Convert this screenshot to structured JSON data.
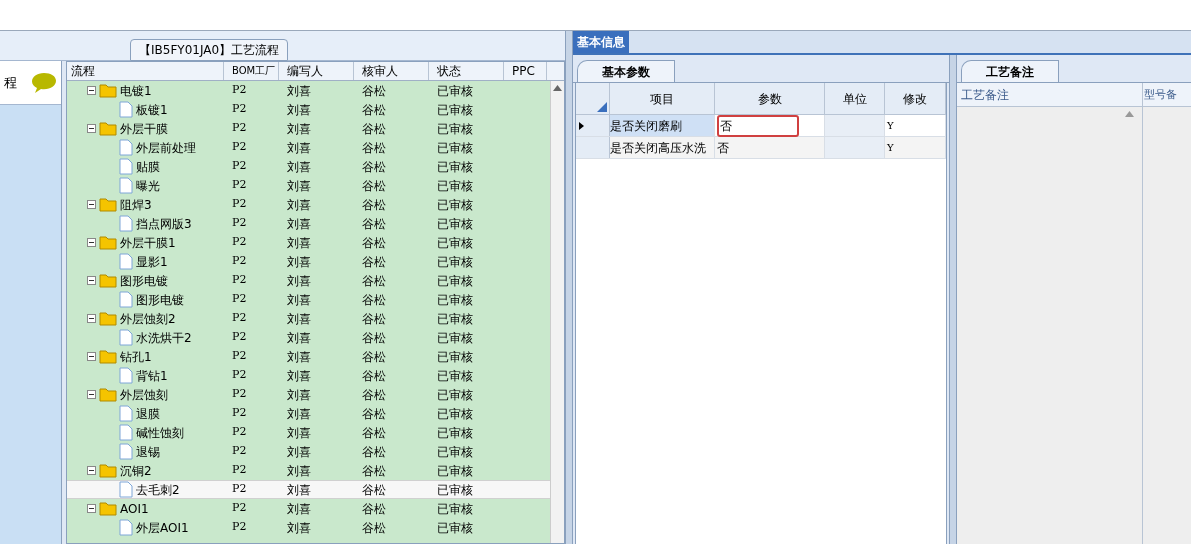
{
  "flow_panel": {
    "title": "【IB5FY01JA0】工艺流程",
    "left_header": "程",
    "columns": [
      "流程",
      "BOM工厂",
      "编写人",
      "核审人",
      "状态",
      "PPC"
    ],
    "tree": [
      {
        "label": "电镀1",
        "bom": "P2",
        "writer": "刘喜",
        "reviewer": "谷松",
        "status": "已审核",
        "selected": false,
        "children": [
          {
            "label": "板镀1",
            "bom": "P2",
            "writer": "刘喜",
            "reviewer": "谷松",
            "status": "已审核",
            "selected": false
          }
        ]
      },
      {
        "label": "外层干膜",
        "bom": "P2",
        "writer": "刘喜",
        "reviewer": "谷松",
        "status": "已审核",
        "selected": false,
        "children": [
          {
            "label": "外层前处理",
            "bom": "P2",
            "writer": "刘喜",
            "reviewer": "谷松",
            "status": "已审核",
            "selected": false
          },
          {
            "label": "贴膜",
            "bom": "P2",
            "writer": "刘喜",
            "reviewer": "谷松",
            "status": "已审核",
            "selected": false
          },
          {
            "label": "曝光",
            "bom": "P2",
            "writer": "刘喜",
            "reviewer": "谷松",
            "status": "已审核",
            "selected": false
          }
        ]
      },
      {
        "label": "阻焊3",
        "bom": "P2",
        "writer": "刘喜",
        "reviewer": "谷松",
        "status": "已审核",
        "selected": false,
        "children": [
          {
            "label": "挡点网版3",
            "bom": "P2",
            "writer": "刘喜",
            "reviewer": "谷松",
            "status": "已审核",
            "selected": false
          }
        ]
      },
      {
        "label": "外层干膜1",
        "bom": "P2",
        "writer": "刘喜",
        "reviewer": "谷松",
        "status": "已审核",
        "selected": false,
        "children": [
          {
            "label": "显影1",
            "bom": "P2",
            "writer": "刘喜",
            "reviewer": "谷松",
            "status": "已审核",
            "selected": false
          }
        ]
      },
      {
        "label": "图形电镀",
        "bom": "P2",
        "writer": "刘喜",
        "reviewer": "谷松",
        "status": "已审核",
        "selected": false,
        "children": [
          {
            "label": "图形电镀",
            "bom": "P2",
            "writer": "刘喜",
            "reviewer": "谷松",
            "status": "已审核",
            "selected": false
          }
        ]
      },
      {
        "label": "外层蚀刻2",
        "bom": "P2",
        "writer": "刘喜",
        "reviewer": "谷松",
        "status": "已审核",
        "selected": false,
        "children": [
          {
            "label": "水洗烘干2",
            "bom": "P2",
            "writer": "刘喜",
            "reviewer": "谷松",
            "status": "已审核",
            "selected": false
          }
        ]
      },
      {
        "label": "钻孔1",
        "bom": "P2",
        "writer": "刘喜",
        "reviewer": "谷松",
        "status": "已审核",
        "selected": false,
        "children": [
          {
            "label": "背钻1",
            "bom": "P2",
            "writer": "刘喜",
            "reviewer": "谷松",
            "status": "已审核",
            "selected": false
          }
        ]
      },
      {
        "label": "外层蚀刻",
        "bom": "P2",
        "writer": "刘喜",
        "reviewer": "谷松",
        "status": "已审核",
        "selected": false,
        "children": [
          {
            "label": "退膜",
            "bom": "P2",
            "writer": "刘喜",
            "reviewer": "谷松",
            "status": "已审核",
            "selected": false
          },
          {
            "label": "碱性蚀刻",
            "bom": "P2",
            "writer": "刘喜",
            "reviewer": "谷松",
            "status": "已审核",
            "selected": false
          },
          {
            "label": "退锡",
            "bom": "P2",
            "writer": "刘喜",
            "reviewer": "谷松",
            "status": "已审核",
            "selected": false
          }
        ]
      },
      {
        "label": "沉铜2",
        "bom": "P2",
        "writer": "刘喜",
        "reviewer": "谷松",
        "status": "已审核",
        "selected": false,
        "children": [
          {
            "label": "去毛刺2",
            "bom": "P2",
            "writer": "刘喜",
            "reviewer": "谷松",
            "status": "已审核",
            "selected": true
          }
        ]
      },
      {
        "label": "AOI1",
        "bom": "P2",
        "writer": "刘喜",
        "reviewer": "谷松",
        "status": "已审核",
        "selected": false,
        "children": [
          {
            "label": "外层AOI1",
            "bom": "P2",
            "writer": "刘喜",
            "reviewer": "谷松",
            "status": "已审核",
            "selected": false
          }
        ]
      }
    ]
  },
  "info_tab": {
    "label": "基本信息",
    "selected": true
  },
  "params": {
    "tab": "基本参数",
    "columns": [
      "项目",
      "参数",
      "单位",
      "修改"
    ],
    "rows": [
      {
        "item": "是否关闭磨刷",
        "value": "否",
        "unit": "",
        "modify": "Y",
        "selected": true
      },
      {
        "item": "是否关闭高压水洗",
        "value": "否",
        "unit": "",
        "modify": "Y",
        "selected": false
      }
    ]
  },
  "notes": {
    "tab": "工艺备注",
    "columns": [
      "工艺备注",
      "型号备"
    ]
  }
}
